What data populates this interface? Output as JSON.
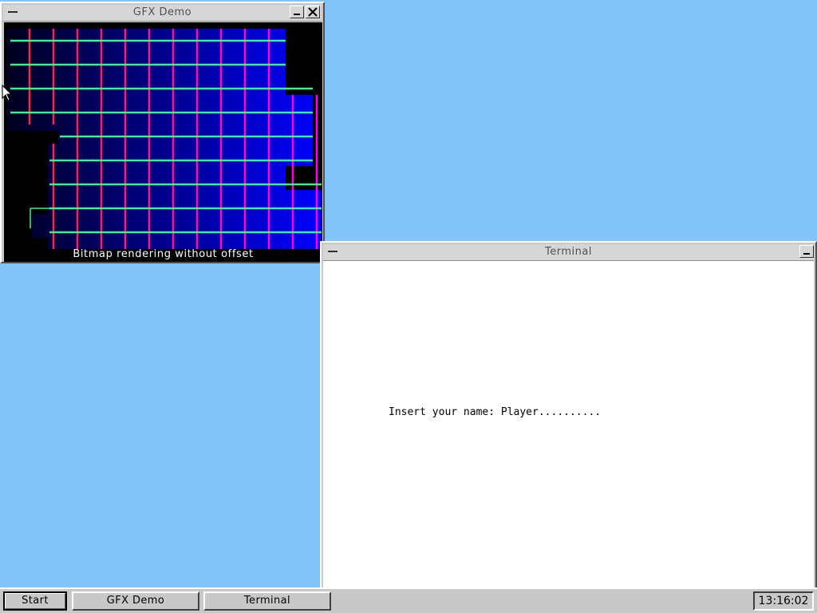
{
  "gfx_window": {
    "title": "GFX Demo",
    "caption": "Bitmap rendering without offset",
    "colors": {
      "line_v": "#ff2a2a",
      "line_h": "#2aff7a",
      "bg": "#000000",
      "gradient_from": "#000030",
      "gradient_to": "#0000ff"
    }
  },
  "terminal_window": {
    "title": "Terminal",
    "prompt": "Insert your name: Player.........."
  },
  "taskbar": {
    "start_label": "Start",
    "tasks": [
      {
        "label": "GFX Demo"
      },
      {
        "label": "Terminal"
      }
    ],
    "clock": "13:16:02"
  }
}
